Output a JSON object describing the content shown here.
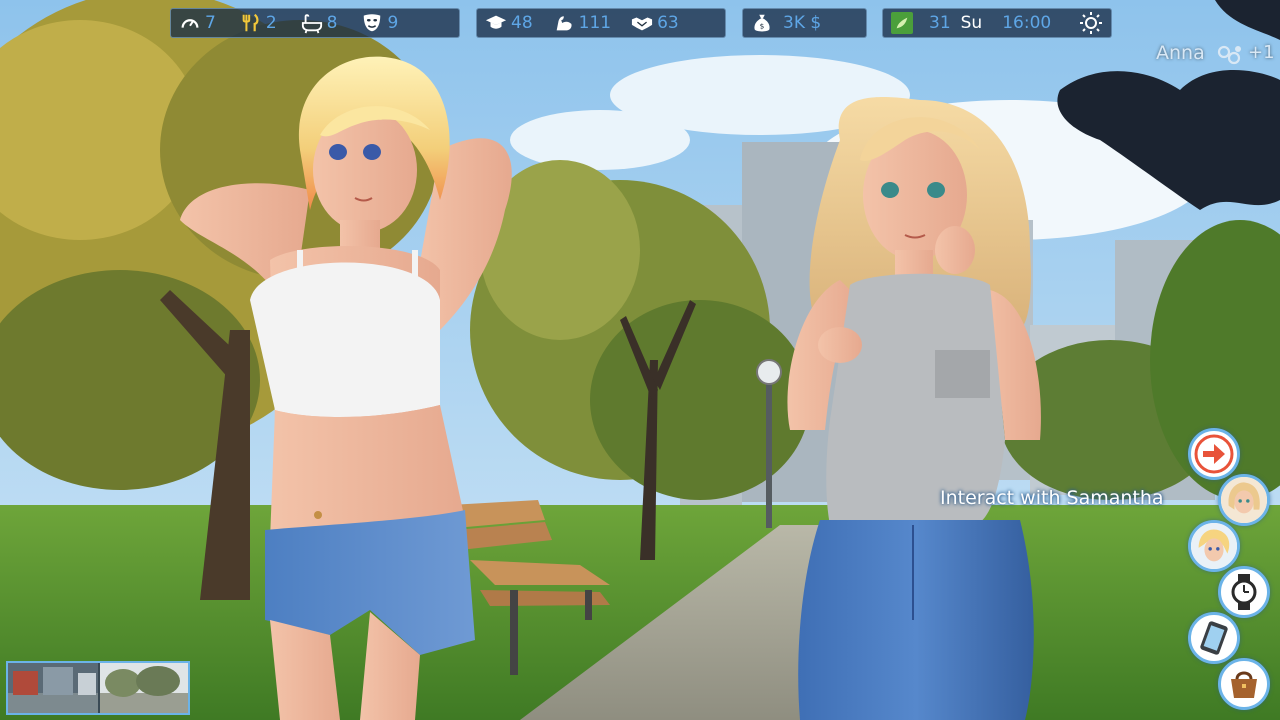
{
  "hud": {
    "needs": [
      {
        "icon": "energy-gauge-icon",
        "value": "7"
      },
      {
        "icon": "fork-knife-icon",
        "value": "2"
      },
      {
        "icon": "bathtub-icon",
        "value": "8"
      },
      {
        "icon": "mood-mask-icon",
        "value": "9"
      }
    ],
    "skills": [
      {
        "icon": "graduation-cap-icon",
        "value": "48"
      },
      {
        "icon": "muscle-arm-icon",
        "value": "111"
      },
      {
        "icon": "handshake-icon",
        "value": "63"
      }
    ],
    "money": {
      "icon": "money-bag-icon",
      "value": "3K $"
    },
    "calendar": {
      "icon": "calendar-icon",
      "day": "31",
      "weekday": "Su",
      "time": "16:00",
      "weather_icon": "sun-icon"
    }
  },
  "npc": {
    "name": "Anna",
    "extra": "+1"
  },
  "interact": {
    "label": "Interact with Samantha"
  },
  "colors": {
    "hud_value": "#5ea6e6",
    "button_ring": "#6bb3e8",
    "arrow": "#e8533a"
  }
}
